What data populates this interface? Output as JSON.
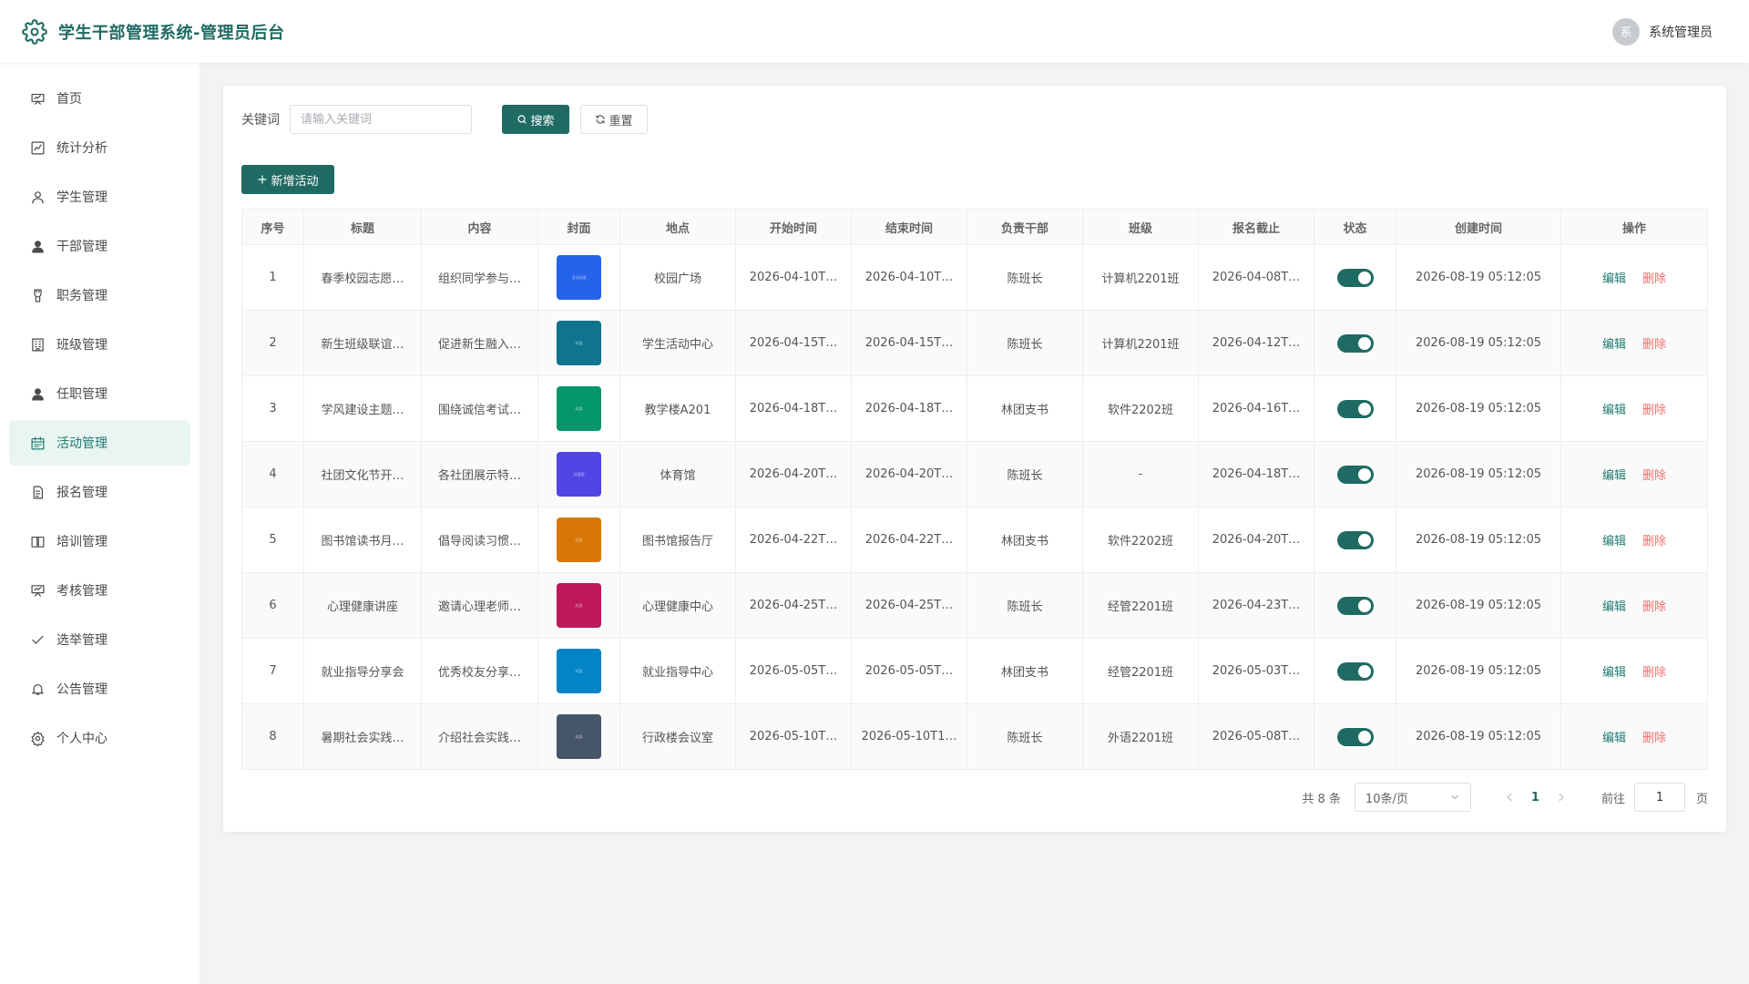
{
  "header": {
    "title": "学生干部管理系统-管理员后台",
    "avatar_text": "系",
    "user_name": "系统管理员"
  },
  "sidebar": {
    "items": [
      {
        "label": "首页",
        "icon": "home-icon"
      },
      {
        "label": "统计分析",
        "icon": "chart-icon"
      },
      {
        "label": "学生管理",
        "icon": "user-icon"
      },
      {
        "label": "干部管理",
        "icon": "user-filled-icon"
      },
      {
        "label": "职务管理",
        "icon": "badge-icon"
      },
      {
        "label": "班级管理",
        "icon": "office-building-icon"
      },
      {
        "label": "任职管理",
        "icon": "user-filled-icon"
      },
      {
        "label": "活动管理",
        "icon": "calendar-icon",
        "active": true
      },
      {
        "label": "报名管理",
        "icon": "document-icon"
      },
      {
        "label": "培训管理",
        "icon": "book-icon"
      },
      {
        "label": "考核管理",
        "icon": "presentation-icon"
      },
      {
        "label": "选举管理",
        "icon": "check-icon"
      },
      {
        "label": "公告管理",
        "icon": "bell-icon"
      },
      {
        "label": "个人中心",
        "icon": "settings-icon"
      }
    ]
  },
  "search": {
    "label": "关键词",
    "placeholder": "请输入关键词",
    "value": "",
    "search_button": "搜索",
    "reset_button": "重置"
  },
  "toolbar": {
    "add_button": "新增活动"
  },
  "table": {
    "columns": [
      "序号",
      "标题",
      "内容",
      "封面",
      "地点",
      "开始时间",
      "结束时间",
      "负责干部",
      "班级",
      "报名截止",
      "状态",
      "创建时间",
      "操作"
    ],
    "edit_label": "编辑",
    "delete_label": "删除",
    "rows": [
      {
        "no": "1",
        "title": "春季校园志愿…",
        "content": "组织同学参与…",
        "cover_color": "#2563eb",
        "cover_text": "活动封面",
        "place": "校园广场",
        "start": "2026-04-10T…",
        "end": "2026-04-10T…",
        "leader": "陈班长",
        "class": "计算机2201班",
        "deadline": "2026-04-08T…",
        "status": true,
        "created": "2026-08-19 05:12:05"
      },
      {
        "no": "2",
        "title": "新生班级联谊…",
        "content": "促进新生融入…",
        "cover_color": "#0e7490",
        "cover_text": "封面",
        "place": "学生活动中心",
        "start": "2026-04-15T…",
        "end": "2026-04-15T…",
        "leader": "陈班长",
        "class": "计算机2201班",
        "deadline": "2026-04-12T…",
        "status": true,
        "created": "2026-08-19 05:12:05"
      },
      {
        "no": "3",
        "title": "学风建设主题…",
        "content": "围绕诚信考试…",
        "cover_color": "#059669",
        "cover_text": "封面",
        "place": "教学楼A201",
        "start": "2026-04-18T…",
        "end": "2026-04-18T…",
        "leader": "林团支书",
        "class": "软件2202班",
        "deadline": "2026-04-16T…",
        "status": true,
        "created": "2026-08-19 05:12:05"
      },
      {
        "no": "4",
        "title": "社团文化节开…",
        "content": "各社团展示特…",
        "cover_color": "#4f46e5",
        "cover_text": "封面图",
        "place": "体育馆",
        "start": "2026-04-20T…",
        "end": "2026-04-20T…",
        "leader": "陈班长",
        "class": "-",
        "deadline": "2026-04-18T…",
        "status": true,
        "created": "2026-08-19 05:12:05"
      },
      {
        "no": "5",
        "title": "图书馆读书月…",
        "content": "倡导阅读习惯…",
        "cover_color": "#d97706",
        "cover_text": "封面",
        "place": "图书馆报告厅",
        "start": "2026-04-22T…",
        "end": "2026-04-22T…",
        "leader": "林团支书",
        "class": "软件2202班",
        "deadline": "2026-04-20T…",
        "status": true,
        "created": "2026-08-19 05:12:05"
      },
      {
        "no": "6",
        "title": "心理健康讲座",
        "content": "邀请心理老师…",
        "cover_color": "#be185d",
        "cover_text": "封面",
        "place": "心理健康中心",
        "start": "2026-04-25T…",
        "end": "2026-04-25T…",
        "leader": "陈班长",
        "class": "经管2201班",
        "deadline": "2026-04-23T…",
        "status": true,
        "created": "2026-08-19 05:12:05"
      },
      {
        "no": "7",
        "title": "就业指导分享会",
        "content": "优秀校友分享…",
        "cover_color": "#0284c7",
        "cover_text": "封面",
        "place": "就业指导中心",
        "start": "2026-05-05T…",
        "end": "2026-05-05T…",
        "leader": "林团支书",
        "class": "经管2201班",
        "deadline": "2026-05-03T…",
        "status": true,
        "created": "2026-08-19 05:12:05"
      },
      {
        "no": "8",
        "title": "暑期社会实践…",
        "content": "介绍社会实践…",
        "cover_color": "#475569",
        "cover_text": "封面",
        "place": "行政楼会议室",
        "start": "2026-05-10T…",
        "end": "2026-05-10T1…",
        "leader": "陈班长",
        "class": "外语2201班",
        "deadline": "2026-05-08T…",
        "status": true,
        "created": "2026-08-19 05:12:05"
      }
    ]
  },
  "pagination": {
    "total_text": "共 8 条",
    "page_size": "10条/页",
    "current_page": "1",
    "goto_label": "前往",
    "goto_value": "1",
    "page_unit": "页"
  },
  "colors": {
    "primary": "#1f6b63",
    "active_bg": "#e9f5f1",
    "danger": "#f56c6c"
  }
}
